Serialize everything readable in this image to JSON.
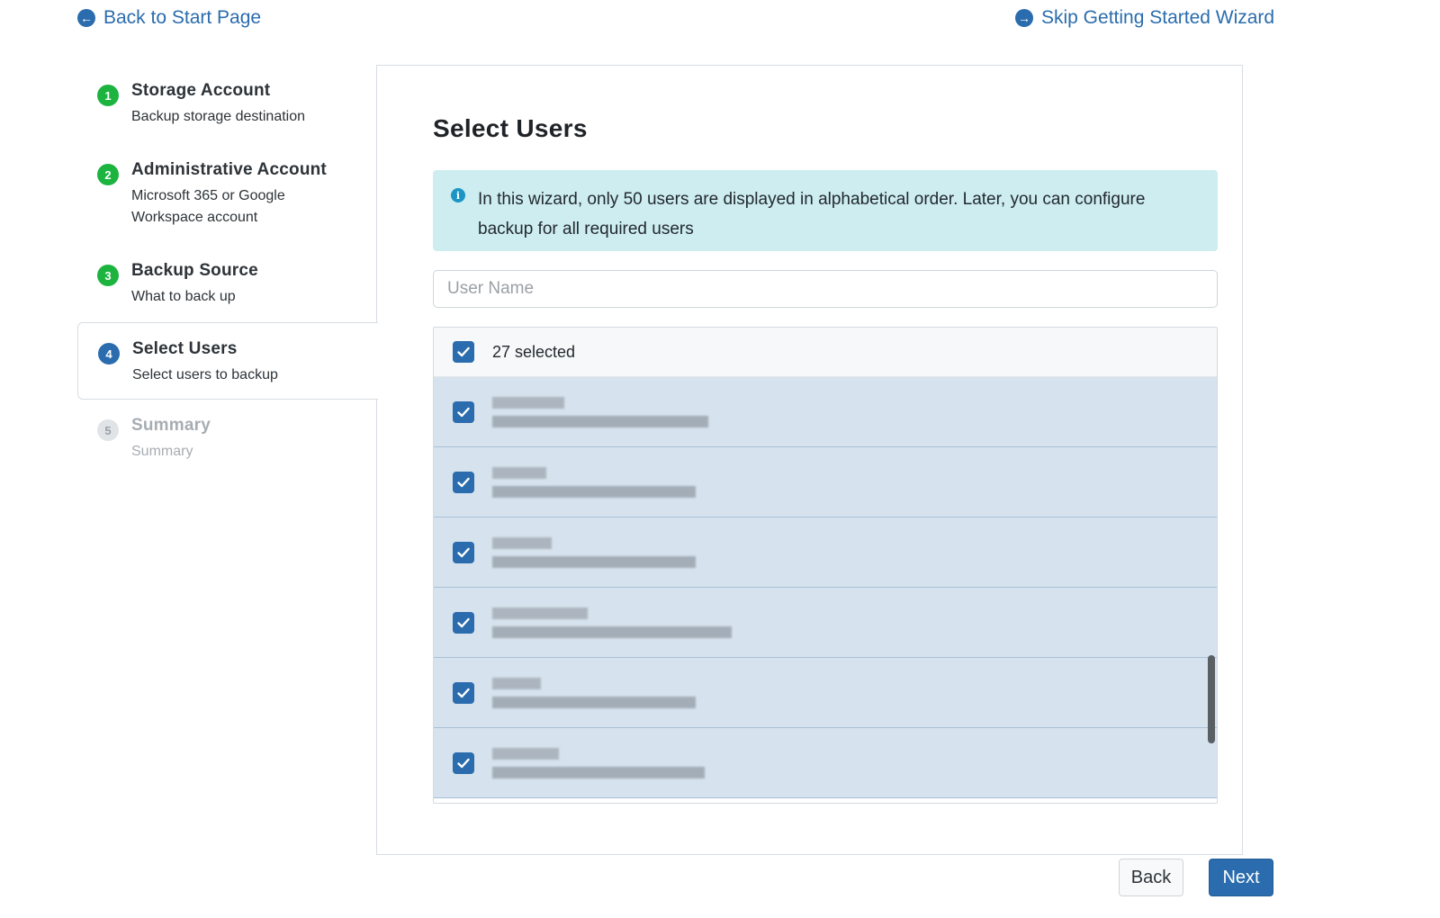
{
  "top_links": {
    "back": "Back to Start Page",
    "skip": "Skip Getting Started Wizard"
  },
  "steps": [
    {
      "number": "1",
      "title": "Storage Account",
      "subtitle": "Backup storage destination",
      "state": "completed"
    },
    {
      "number": "2",
      "title": "Administrative Account",
      "subtitle": "Microsoft 365 or Google Workspace account",
      "state": "completed"
    },
    {
      "number": "3",
      "title": "Backup Source",
      "subtitle": "What to back up",
      "state": "completed"
    },
    {
      "number": "4",
      "title": "Select Users",
      "subtitle": "Select users to backup",
      "state": "active"
    },
    {
      "number": "5",
      "title": "Summary",
      "subtitle": "Summary",
      "state": "disabled"
    }
  ],
  "main": {
    "title": "Select Users",
    "info_text": "In this wizard, only 50 users are displayed in alphabetical order. Later, you can configure backup for all required users",
    "search_placeholder": "User Name",
    "search_value": "",
    "selected_label": "27 selected",
    "users": [
      {
        "checked": true
      },
      {
        "checked": true
      },
      {
        "checked": true
      },
      {
        "checked": true
      },
      {
        "checked": true
      },
      {
        "checked": true
      }
    ]
  },
  "buttons": {
    "back": "Back",
    "next": "Next"
  },
  "colors": {
    "accent": "#2a6cad",
    "step_done": "#1cb43f",
    "info_bg": "#cdedf1",
    "row_selected": "#d6e2ed"
  }
}
